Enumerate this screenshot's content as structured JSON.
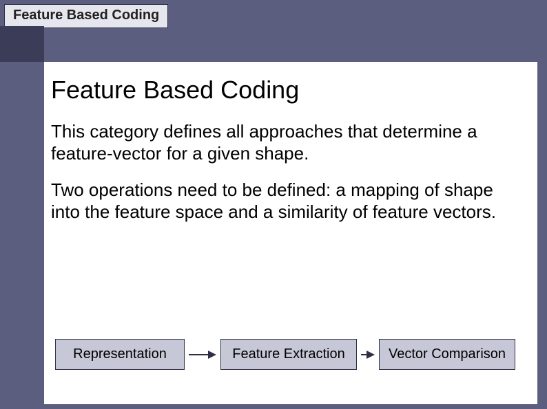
{
  "tab": {
    "label": "Feature Based Coding"
  },
  "content": {
    "title": "Feature Based Coding",
    "para1": "This category defines all approaches that determine a feature-vector for a given shape.",
    "para2": "Two operations need to be defined: a mapping of shape into the feature space and a similarity of feature vectors."
  },
  "flow": {
    "box1": "Representation",
    "box2": "Feature Extraction",
    "box3": "Vector Comparison"
  }
}
